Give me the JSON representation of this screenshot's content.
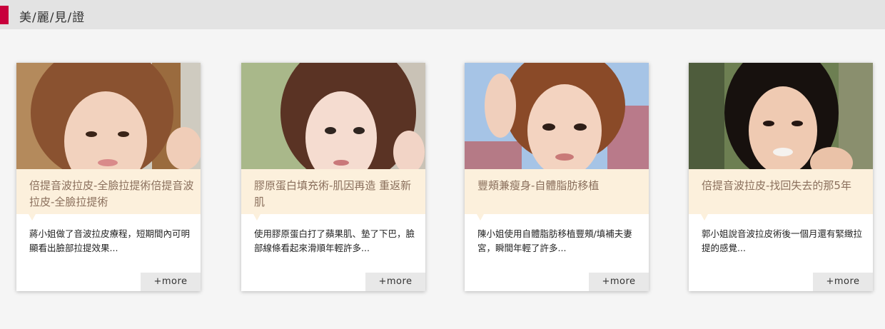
{
  "header": {
    "title": "美/麗/見/證",
    "accent_color": "#c8003c"
  },
  "cards": [
    {
      "title": "倍提音波拉皮-全臉拉提術倍提音波拉皮-全臉拉提術",
      "description": "蔣小姐做了音波拉皮療程，短期間內可明顯看出臉部拉提效果...",
      "more": "+more"
    },
    {
      "title": "膠原蛋白填充術-肌因再造 重返新肌",
      "description": "使用膠原蛋白打了蘋果肌、墊了下巴，臉部線條看起來滑順年輕許多...",
      "more": "+more"
    },
    {
      "title": "豐頰兼瘦身-自體脂肪移植",
      "description": "陳小姐使用自體脂肪移植豐頰/填補夫妻宮，瞬間年輕了許多...",
      "more": "+more"
    },
    {
      "title": "倍提音波拉皮-找回失去的那5年",
      "description": "郭小姐說音波拉皮術後一個月還有緊緻拉提的感覺...",
      "more": "+more"
    }
  ]
}
